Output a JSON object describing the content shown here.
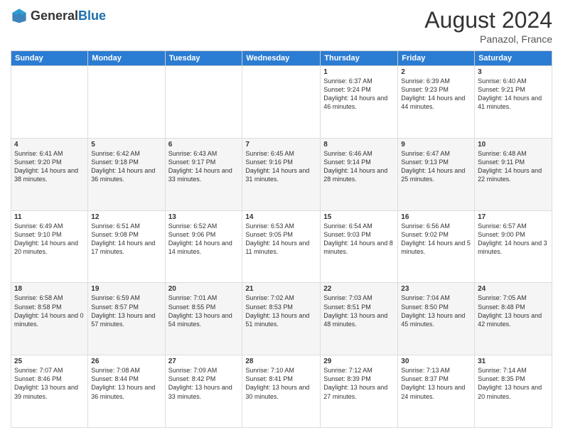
{
  "header": {
    "logo_general": "General",
    "logo_blue": "Blue",
    "month_year": "August 2024",
    "location": "Panazol, France"
  },
  "days_of_week": [
    "Sunday",
    "Monday",
    "Tuesday",
    "Wednesday",
    "Thursday",
    "Friday",
    "Saturday"
  ],
  "weeks": [
    [
      {
        "day": "",
        "info": ""
      },
      {
        "day": "",
        "info": ""
      },
      {
        "day": "",
        "info": ""
      },
      {
        "day": "",
        "info": ""
      },
      {
        "day": "1",
        "info": "Sunrise: 6:37 AM\nSunset: 9:24 PM\nDaylight: 14 hours and 46 minutes."
      },
      {
        "day": "2",
        "info": "Sunrise: 6:39 AM\nSunset: 9:23 PM\nDaylight: 14 hours and 44 minutes."
      },
      {
        "day": "3",
        "info": "Sunrise: 6:40 AM\nSunset: 9:21 PM\nDaylight: 14 hours and 41 minutes."
      }
    ],
    [
      {
        "day": "4",
        "info": "Sunrise: 6:41 AM\nSunset: 9:20 PM\nDaylight: 14 hours and 38 minutes."
      },
      {
        "day": "5",
        "info": "Sunrise: 6:42 AM\nSunset: 9:18 PM\nDaylight: 14 hours and 36 minutes."
      },
      {
        "day": "6",
        "info": "Sunrise: 6:43 AM\nSunset: 9:17 PM\nDaylight: 14 hours and 33 minutes."
      },
      {
        "day": "7",
        "info": "Sunrise: 6:45 AM\nSunset: 9:16 PM\nDaylight: 14 hours and 31 minutes."
      },
      {
        "day": "8",
        "info": "Sunrise: 6:46 AM\nSunset: 9:14 PM\nDaylight: 14 hours and 28 minutes."
      },
      {
        "day": "9",
        "info": "Sunrise: 6:47 AM\nSunset: 9:13 PM\nDaylight: 14 hours and 25 minutes."
      },
      {
        "day": "10",
        "info": "Sunrise: 6:48 AM\nSunset: 9:11 PM\nDaylight: 14 hours and 22 minutes."
      }
    ],
    [
      {
        "day": "11",
        "info": "Sunrise: 6:49 AM\nSunset: 9:10 PM\nDaylight: 14 hours and 20 minutes."
      },
      {
        "day": "12",
        "info": "Sunrise: 6:51 AM\nSunset: 9:08 PM\nDaylight: 14 hours and 17 minutes."
      },
      {
        "day": "13",
        "info": "Sunrise: 6:52 AM\nSunset: 9:06 PM\nDaylight: 14 hours and 14 minutes."
      },
      {
        "day": "14",
        "info": "Sunrise: 6:53 AM\nSunset: 9:05 PM\nDaylight: 14 hours and 11 minutes."
      },
      {
        "day": "15",
        "info": "Sunrise: 6:54 AM\nSunset: 9:03 PM\nDaylight: 14 hours and 8 minutes."
      },
      {
        "day": "16",
        "info": "Sunrise: 6:56 AM\nSunset: 9:02 PM\nDaylight: 14 hours and 5 minutes."
      },
      {
        "day": "17",
        "info": "Sunrise: 6:57 AM\nSunset: 9:00 PM\nDaylight: 14 hours and 3 minutes."
      }
    ],
    [
      {
        "day": "18",
        "info": "Sunrise: 6:58 AM\nSunset: 8:58 PM\nDaylight: 14 hours and 0 minutes."
      },
      {
        "day": "19",
        "info": "Sunrise: 6:59 AM\nSunset: 8:57 PM\nDaylight: 13 hours and 57 minutes."
      },
      {
        "day": "20",
        "info": "Sunrise: 7:01 AM\nSunset: 8:55 PM\nDaylight: 13 hours and 54 minutes."
      },
      {
        "day": "21",
        "info": "Sunrise: 7:02 AM\nSunset: 8:53 PM\nDaylight: 13 hours and 51 minutes."
      },
      {
        "day": "22",
        "info": "Sunrise: 7:03 AM\nSunset: 8:51 PM\nDaylight: 13 hours and 48 minutes."
      },
      {
        "day": "23",
        "info": "Sunrise: 7:04 AM\nSunset: 8:50 PM\nDaylight: 13 hours and 45 minutes."
      },
      {
        "day": "24",
        "info": "Sunrise: 7:05 AM\nSunset: 8:48 PM\nDaylight: 13 hours and 42 minutes."
      }
    ],
    [
      {
        "day": "25",
        "info": "Sunrise: 7:07 AM\nSunset: 8:46 PM\nDaylight: 13 hours and 39 minutes."
      },
      {
        "day": "26",
        "info": "Sunrise: 7:08 AM\nSunset: 8:44 PM\nDaylight: 13 hours and 36 minutes."
      },
      {
        "day": "27",
        "info": "Sunrise: 7:09 AM\nSunset: 8:42 PM\nDaylight: 13 hours and 33 minutes."
      },
      {
        "day": "28",
        "info": "Sunrise: 7:10 AM\nSunset: 8:41 PM\nDaylight: 13 hours and 30 minutes."
      },
      {
        "day": "29",
        "info": "Sunrise: 7:12 AM\nSunset: 8:39 PM\nDaylight: 13 hours and 27 minutes."
      },
      {
        "day": "30",
        "info": "Sunrise: 7:13 AM\nSunset: 8:37 PM\nDaylight: 13 hours and 24 minutes."
      },
      {
        "day": "31",
        "info": "Sunrise: 7:14 AM\nSunset: 8:35 PM\nDaylight: 13 hours and 20 minutes."
      }
    ]
  ]
}
